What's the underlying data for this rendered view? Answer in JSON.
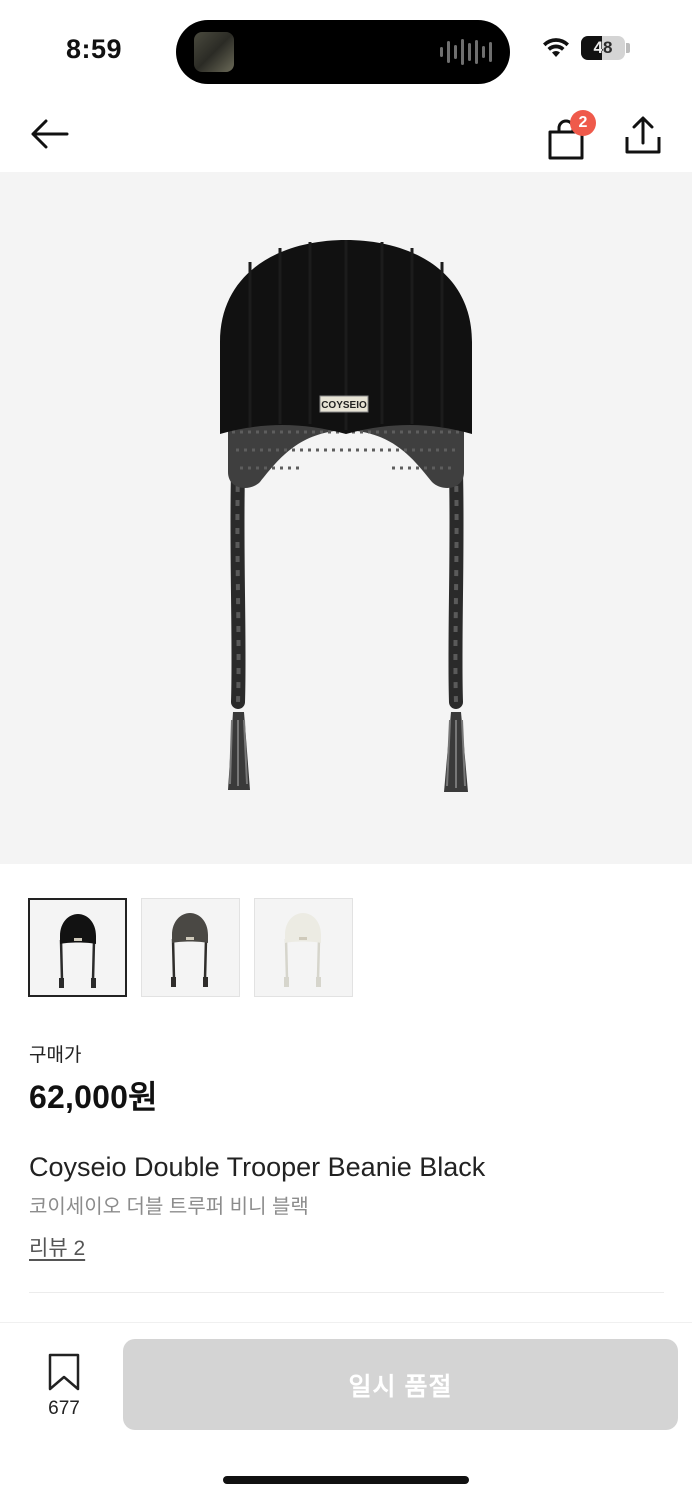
{
  "status": {
    "time": "8:59",
    "battery_level": "48",
    "battery_fraction": 0.48
  },
  "nav": {
    "cart_count": "2",
    "icons": [
      "back-arrow-icon",
      "shopping-bag-icon",
      "share-icon"
    ]
  },
  "product": {
    "logo_text": "COYSEIO",
    "price_label": "구매가",
    "price": "62,000원",
    "title_en": "Coyseio Double Trooper Beanie Black",
    "title_ko": "코이세이오 더블 트루퍼 비니 블랙",
    "review_link": "리뷰 2",
    "variants": [
      {
        "color": "#121212",
        "tie": "#2a2a2a"
      },
      {
        "color": "#4a4844",
        "tie": "#2f2d2b"
      },
      {
        "color": "#ecebe3",
        "tie": "#d6d5cc"
      }
    ],
    "selected_variant": 0
  },
  "bottom": {
    "bookmark_count": "677",
    "sold_out_label": "일시 품절"
  },
  "colors": {
    "badge": "#ef5a4b",
    "hero_bg": "#f4f4f4",
    "disabled_button": "#d4d4d4"
  }
}
